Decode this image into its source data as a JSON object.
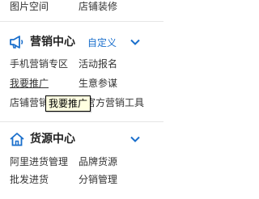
{
  "top_links": [
    {
      "label": "图片空间"
    },
    {
      "label": "店铺装修"
    }
  ],
  "marketing": {
    "title": "营销中心",
    "customize_label": "自定义",
    "icon": "megaphone-icon",
    "items": [
      {
        "label": "手机营销专区"
      },
      {
        "label": "活动报名"
      },
      {
        "label": "我要推广"
      },
      {
        "label": "生意参谋"
      },
      {
        "label": "店铺营销"
      },
      {
        "label": "官方营销工具"
      }
    ]
  },
  "tooltip": "我要推广",
  "sourcing": {
    "title": "货源中心",
    "icon": "house-icon",
    "items": [
      {
        "label": "阿里进货管理"
      },
      {
        "label": "品牌货源"
      },
      {
        "label": "批发进货"
      },
      {
        "label": "分销管理"
      }
    ]
  },
  "colors": {
    "accent": "#1a6fcc",
    "text": "#333333",
    "tooltip_bg": "#ffffe1"
  }
}
